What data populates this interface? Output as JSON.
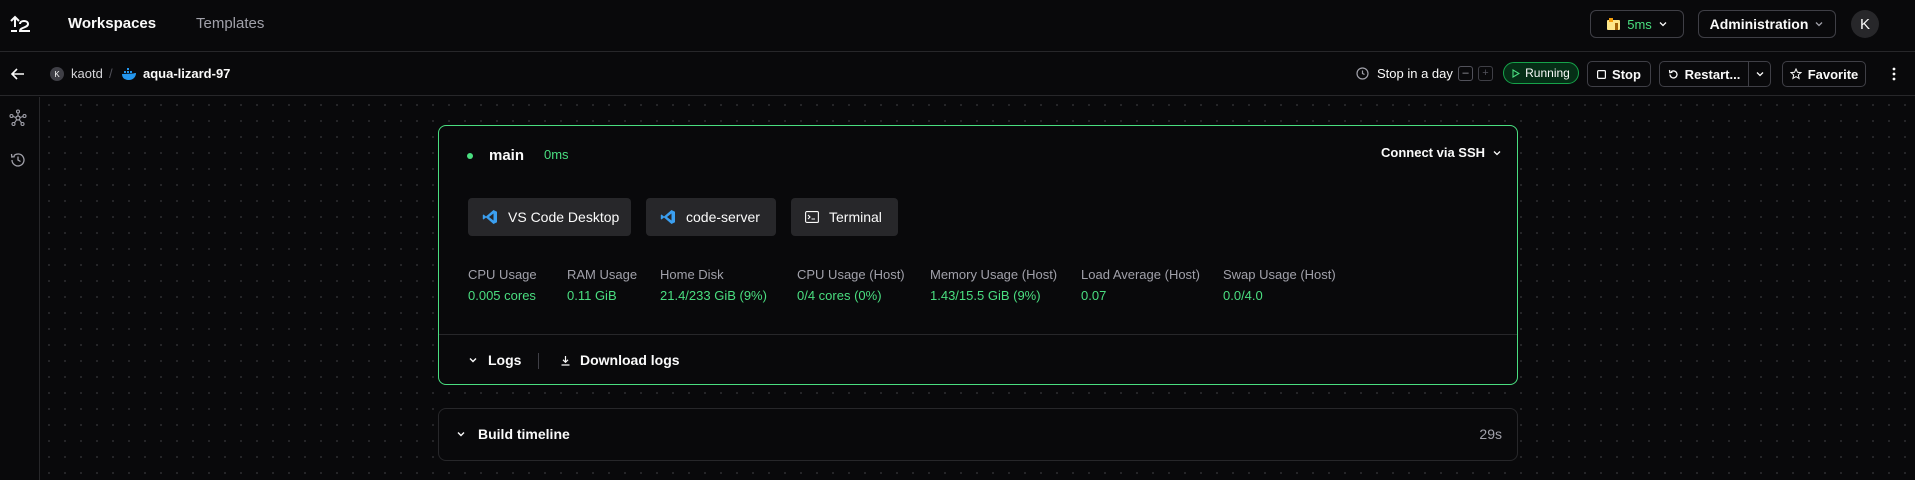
{
  "topnav": {
    "tabs": [
      {
        "label": "Workspaces",
        "active": true
      },
      {
        "label": "Templates",
        "active": false
      }
    ],
    "latency": "5ms",
    "admin_label": "Administration",
    "user_initial": "K"
  },
  "workspace_header": {
    "owner_initial": "K",
    "owner": "kaotd",
    "separator": "/",
    "workspace_name": "aqua-lizard-97",
    "schedule": "Stop in a day",
    "decrement": "–",
    "increment": "+",
    "status": "Running",
    "actions": {
      "stop": "Stop",
      "restart": "Restart...",
      "favorite": "Favorite"
    }
  },
  "agent": {
    "name": "main",
    "latency": "0ms",
    "connect_label": "Connect via SSH",
    "apps": [
      {
        "label": "VS Code Desktop",
        "icon": "vscode-icon"
      },
      {
        "label": "code-server",
        "icon": "vscode-icon"
      },
      {
        "label": "Terminal",
        "icon": "terminal-icon"
      }
    ],
    "stats": [
      {
        "label": "CPU Usage",
        "value": "0.005 cores"
      },
      {
        "label": "RAM Usage",
        "value": "0.11 GiB"
      },
      {
        "label": "Home Disk",
        "value": "21.4/233 GiB (9%)"
      },
      {
        "label": "CPU Usage (Host)",
        "value": "0/4 cores (0%)"
      },
      {
        "label": "Memory Usage (Host)",
        "value": "1.43/15.5 GiB (9%)"
      },
      {
        "label": "Load Average (Host)",
        "value": "0.07"
      },
      {
        "label": "Swap Usage (Host)",
        "value": "0.0/4.0"
      }
    ],
    "logs_label": "Logs",
    "download_logs_label": "Download logs"
  },
  "build_timeline": {
    "label": "Build timeline",
    "duration": "29s"
  },
  "colors": {
    "background": "#09090b",
    "border": "#27272a",
    "success": "#4ade80",
    "vscode_blue": "#3b9ff0"
  }
}
